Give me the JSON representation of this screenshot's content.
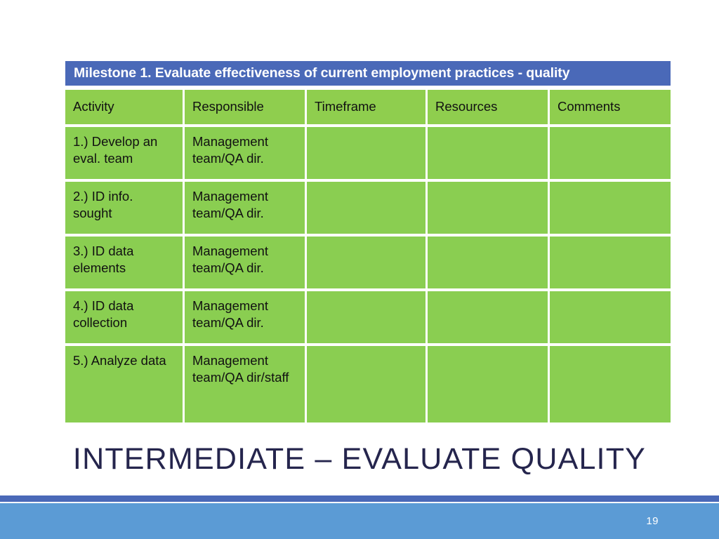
{
  "slide": {
    "title": "INTERMEDIATE – EVALUATE QUALITY",
    "page_number": "19",
    "colors": {
      "milestone_bar": "#4A69B8",
      "table_green": "#8ACE51",
      "header_green": "#8FCE4E",
      "title_navy": "#25254D",
      "footer_blue": "#5B9BD5",
      "footer_rule": "#4A69B8"
    }
  },
  "table": {
    "milestone_heading": "Milestone 1.  Evaluate effectiveness of current employment practices  - quality",
    "columns": [
      "Activity",
      "Responsible",
      "Timeframe",
      "Resources",
      "Comments"
    ],
    "rows": [
      {
        "activity": "1.) Develop an eval. team",
        "responsible": "Management team/QA dir.",
        "timeframe": "",
        "resources": "",
        "comments": ""
      },
      {
        "activity": "2.) ID info. sought",
        "responsible": "Management team/QA dir.",
        "timeframe": "",
        "resources": "",
        "comments": ""
      },
      {
        "activity": "3.) ID data elements",
        "responsible": "Management team/QA dir.",
        "timeframe": "",
        "resources": "",
        "comments": ""
      },
      {
        "activity": "4.) ID data collection",
        "responsible": "Management team/QA dir.",
        "timeframe": "",
        "resources": "",
        "comments": ""
      },
      {
        "activity": "5.) Analyze data",
        "responsible": "Management team/QA dir/staff",
        "timeframe": "",
        "resources": "",
        "comments": ""
      }
    ]
  }
}
